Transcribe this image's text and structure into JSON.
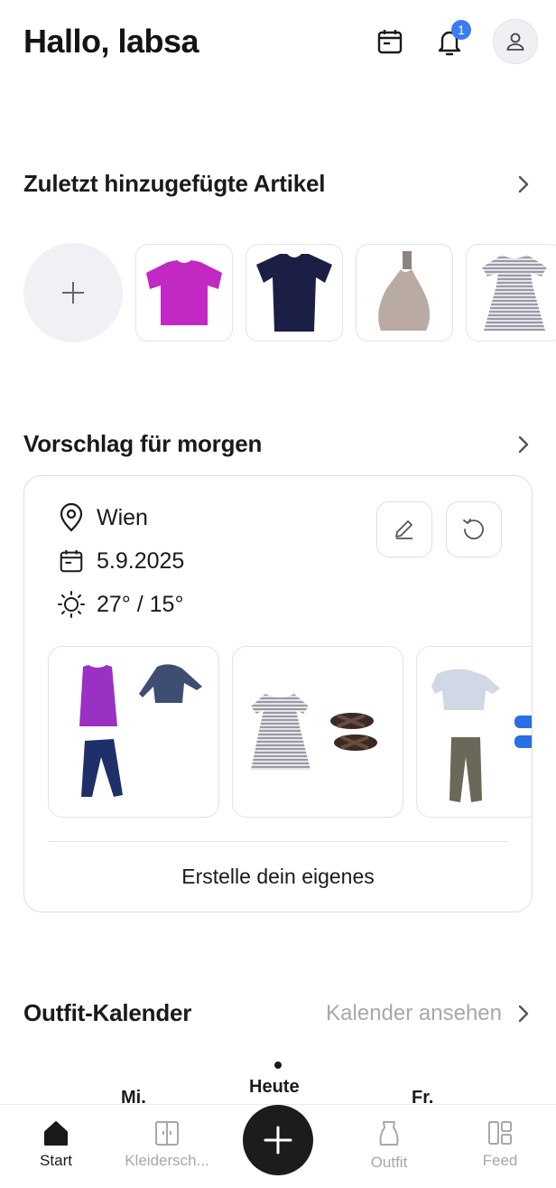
{
  "header": {
    "greeting": "Hallo, labsa",
    "notification_count": "1",
    "icons": [
      "calendar-icon",
      "bell-icon",
      "user-icon"
    ]
  },
  "recent": {
    "title": "Zuletzt hinzugefügte Artikel",
    "items": [
      {
        "name": "pink t-shirt",
        "color": "#c228c4"
      },
      {
        "name": "navy t-shirt",
        "color": "#1c1f45"
      },
      {
        "name": "beige halter top",
        "color": "#b9aaa4"
      },
      {
        "name": "striped dress",
        "color": "#c9c9d0"
      }
    ]
  },
  "suggestion": {
    "title": "Vorschlag für morgen",
    "location": "Wien",
    "date": "5.9.2025",
    "weather": "27° / 15°",
    "create_label": "Erstelle dein eigenes"
  },
  "calendar": {
    "title": "Outfit-Kalender",
    "link_label": "Kalender ansehen",
    "days": [
      {
        "label": "Mi."
      },
      {
        "label": "Heute"
      },
      {
        "label": "Fr."
      }
    ]
  },
  "tabbar": {
    "tabs": [
      {
        "label": "Start",
        "icon": "home-icon",
        "active": true
      },
      {
        "label": "Kleidersch...",
        "icon": "wardrobe-icon",
        "active": false
      },
      {
        "label": "Outfit",
        "icon": "outfit-icon",
        "active": false
      },
      {
        "label": "Feed",
        "icon": "feed-icon",
        "active": false
      }
    ],
    "fab_icon": "plus-icon"
  },
  "colors": {
    "accent_badge": "#3c7cf2",
    "text": "#1a1a1a",
    "muted": "#a7a7ad",
    "fab": "#1c1c1c"
  }
}
